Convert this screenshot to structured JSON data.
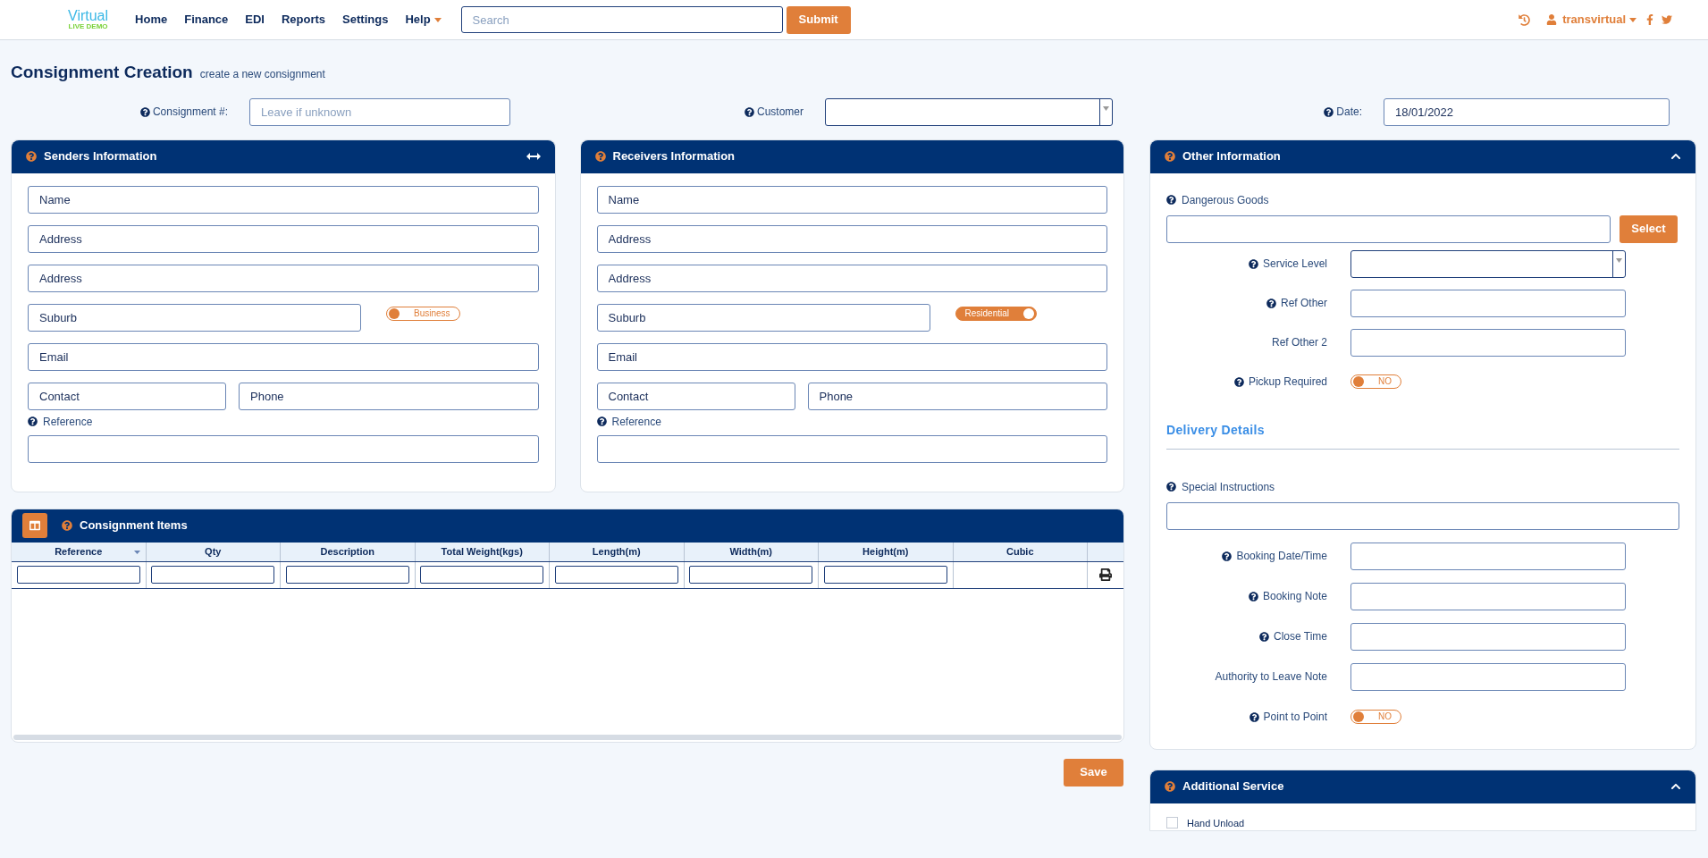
{
  "nav": {
    "logo": "Virtual",
    "logo_sub": "LIVE DEMO",
    "links": [
      {
        "label": "Home",
        "dropdown": false
      },
      {
        "label": "Finance",
        "dropdown": false
      },
      {
        "label": "EDI",
        "dropdown": false
      },
      {
        "label": "Reports",
        "dropdown": false
      },
      {
        "label": "Settings",
        "dropdown": false
      },
      {
        "label": "Help",
        "dropdown": true
      }
    ],
    "search_placeholder": "Search",
    "submit": "Submit",
    "user": "transvirtual"
  },
  "page": {
    "title": "Consignment Creation",
    "subtitle": "create a new consignment"
  },
  "header_fields": [
    {
      "label": "Consignment #:",
      "kind": "input",
      "placeholder": "Leave if unknown"
    },
    {
      "label": "Customer",
      "kind": "select"
    },
    {
      "label": "Date:",
      "kind": "input",
      "value": "18/01/2022"
    }
  ],
  "senders": {
    "title": "Senders Information",
    "fields": [
      {
        "placeholder": "Name"
      },
      {
        "placeholder": "Address"
      },
      {
        "placeholder": "Address"
      },
      {
        "placeholder": "Suburb"
      },
      {
        "placeholder": "Email"
      },
      {
        "placeholder": "Contact"
      },
      {
        "placeholder": "Phone"
      }
    ],
    "toggle": {
      "label": "Business",
      "on": false
    },
    "reference_label": "Reference"
  },
  "receivers": {
    "title": "Receivers Information",
    "fields": [
      {
        "placeholder": "Name"
      },
      {
        "placeholder": "Address"
      },
      {
        "placeholder": "Address"
      },
      {
        "placeholder": "Suburb"
      },
      {
        "placeholder": "Email"
      },
      {
        "placeholder": "Contact"
      },
      {
        "placeholder": "Phone"
      }
    ],
    "toggle": {
      "label": "Residential",
      "on": true
    },
    "reference_label": "Reference"
  },
  "items": {
    "title": "Consignment Items",
    "columns": [
      {
        "label": "Reference",
        "sortable": true
      },
      {
        "label": "Qty",
        "sortable": false
      },
      {
        "label": "Description",
        "sortable": false
      },
      {
        "label": "Total Weight(kgs)",
        "sortable": false
      },
      {
        "label": "Length(m)",
        "sortable": false
      },
      {
        "label": "Width(m)",
        "sortable": false
      },
      {
        "label": "Height(m)",
        "sortable": false
      },
      {
        "label": "Cubic",
        "sortable": false
      }
    ]
  },
  "save": "Save",
  "other": {
    "title": "Other Information",
    "dangerous_goods": "Dangerous Goods",
    "select": "Select",
    "rows": [
      {
        "label": "Service Level",
        "kind": "select",
        "help": true
      },
      {
        "label": "Ref Other",
        "kind": "input",
        "help": true
      },
      {
        "label": "Ref Other 2",
        "kind": "input",
        "help": false
      },
      {
        "label": "Pickup Required",
        "kind": "toggle",
        "help": true,
        "toggle": {
          "label": "NO",
          "on": false
        }
      }
    ],
    "delivery_title": "Delivery Details",
    "special_instructions": "Special Instructions",
    "delivery_rows": [
      {
        "label": "Booking Date/Time",
        "kind": "input",
        "help": true
      },
      {
        "label": "Booking Note",
        "kind": "input",
        "help": true
      },
      {
        "label": "Close Time",
        "kind": "input",
        "help": true
      },
      {
        "label": "Authority to Leave Note",
        "kind": "input",
        "help": false
      },
      {
        "label": "Point to Point",
        "kind": "toggle",
        "help": true,
        "toggle": {
          "label": "NO",
          "on": false
        }
      }
    ]
  },
  "additional": {
    "title": "Additional Service",
    "options": [
      {
        "label": "Hand Unload",
        "checked": false
      }
    ]
  }
}
